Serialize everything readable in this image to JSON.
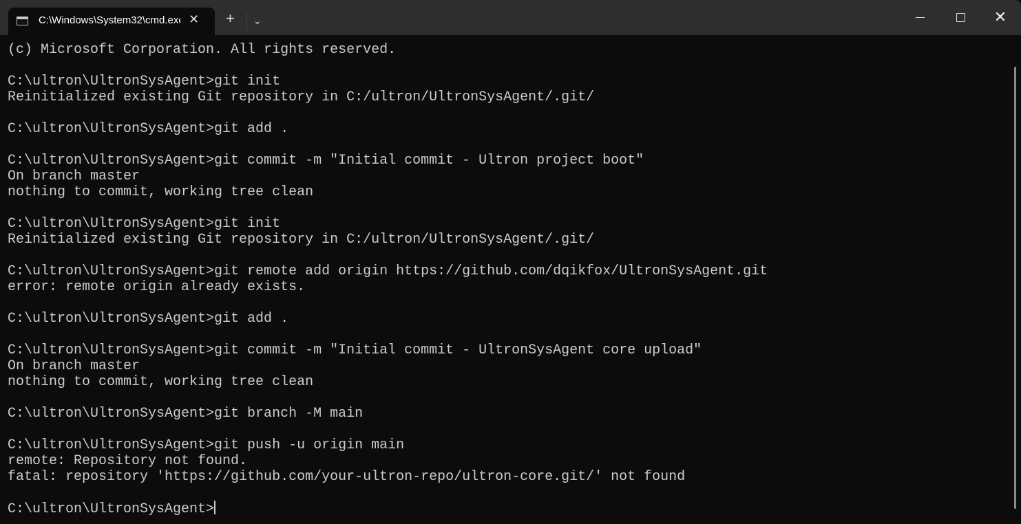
{
  "window": {
    "tab_title": "C:\\Windows\\System32\\cmd.exe",
    "new_tab": "+",
    "dropdown": "⌄",
    "close_tab": "✕",
    "minimize": "",
    "maximize": "",
    "close": "✕"
  },
  "terminal": {
    "lines": [
      "(c) Microsoft Corporation. All rights reserved.",
      "",
      "C:\\ultron\\UltronSysAgent>git init",
      "Reinitialized existing Git repository in C:/ultron/UltronSysAgent/.git/",
      "",
      "C:\\ultron\\UltronSysAgent>git add .",
      "",
      "C:\\ultron\\UltronSysAgent>git commit -m \"Initial commit - Ultron project boot\"",
      "On branch master",
      "nothing to commit, working tree clean",
      "",
      "C:\\ultron\\UltronSysAgent>git init",
      "Reinitialized existing Git repository in C:/ultron/UltronSysAgent/.git/",
      "",
      "C:\\ultron\\UltronSysAgent>git remote add origin https://github.com/dqikfox/UltronSysAgent.git",
      "error: remote origin already exists.",
      "",
      "C:\\ultron\\UltronSysAgent>git add .",
      "",
      "C:\\ultron\\UltronSysAgent>git commit -m \"Initial commit - UltronSysAgent core upload\"",
      "On branch master",
      "nothing to commit, working tree clean",
      "",
      "C:\\ultron\\UltronSysAgent>git branch -M main",
      "",
      "C:\\ultron\\UltronSysAgent>git push -u origin main",
      "remote: Repository not found.",
      "fatal: repository 'https://github.com/your-ultron-repo/ultron-core.git/' not found",
      ""
    ],
    "prompt": "C:\\ultron\\UltronSysAgent>"
  }
}
